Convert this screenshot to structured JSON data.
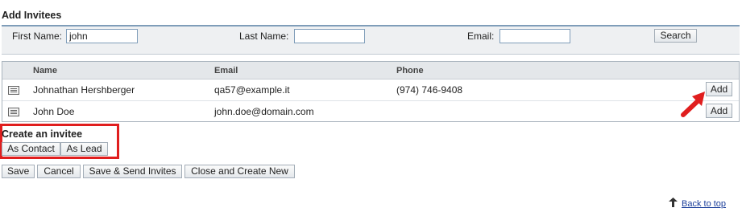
{
  "header": {
    "title": "Add Invitees"
  },
  "search": {
    "first_name_label": "First Name:",
    "first_name_value": "john",
    "last_name_label": "Last Name:",
    "last_name_value": "",
    "email_label": "Email:",
    "email_value": "",
    "search_label": "Search"
  },
  "table": {
    "columns": [
      "Name",
      "Email",
      "Phone"
    ],
    "rows": [
      {
        "name": "Johnathan Hershberger",
        "email": "qa57@example.it",
        "phone": "(974) 746-9408",
        "action": "Add"
      },
      {
        "name": "John Doe",
        "email": "john.doe@domain.com",
        "phone": "",
        "action": "Add"
      }
    ]
  },
  "create": {
    "label": "Create an invitee",
    "as_contact": "As Contact",
    "as_lead": "As Lead"
  },
  "actions": {
    "save": "Save",
    "cancel": "Cancel",
    "save_send": "Save & Send Invites",
    "close_create": "Close and Create New"
  },
  "footer": {
    "back_to_top": "Back to top"
  },
  "colors": {
    "accent_border": "#7f9db9",
    "highlight_red": "#e01e1e",
    "link": "#1a3e9a"
  }
}
